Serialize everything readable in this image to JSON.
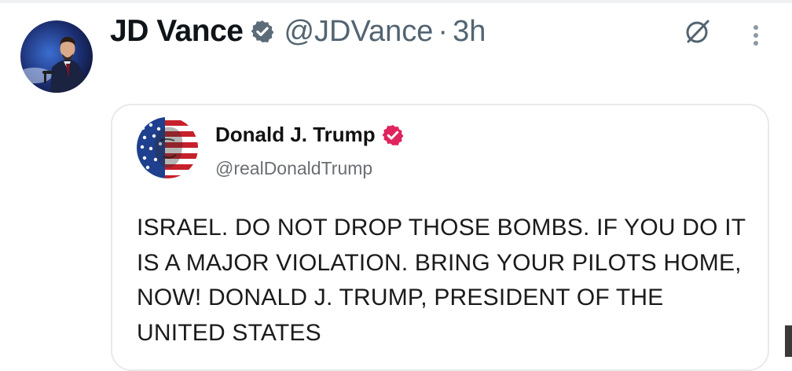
{
  "post": {
    "author_name": "JD Vance",
    "author_handle": "@JDVance",
    "separator": "·",
    "time": "3h",
    "verified_icon": "verified-badge",
    "actions": {
      "grok_icon": "grok-icon",
      "more_icon": "more-vertical-icon"
    },
    "colors": {
      "verified_gold_blue": "#1d9bf0",
      "secondary_text": "#536471"
    }
  },
  "quote": {
    "author_name": "Donald J. Trump",
    "author_handle": "@realDonaldTrump",
    "verified_icon": "verified-badge-pink",
    "verified_color": "#e0245e",
    "text": "ISRAEL. DO NOT DROP THOSE BOMBS. IF YOU DO IT IS A MAJOR VIOLATION. BRING YOUR PILOTS HOME, NOW! DONALD J. TRUMP, PRESIDENT OF THE UNITED STATES"
  }
}
